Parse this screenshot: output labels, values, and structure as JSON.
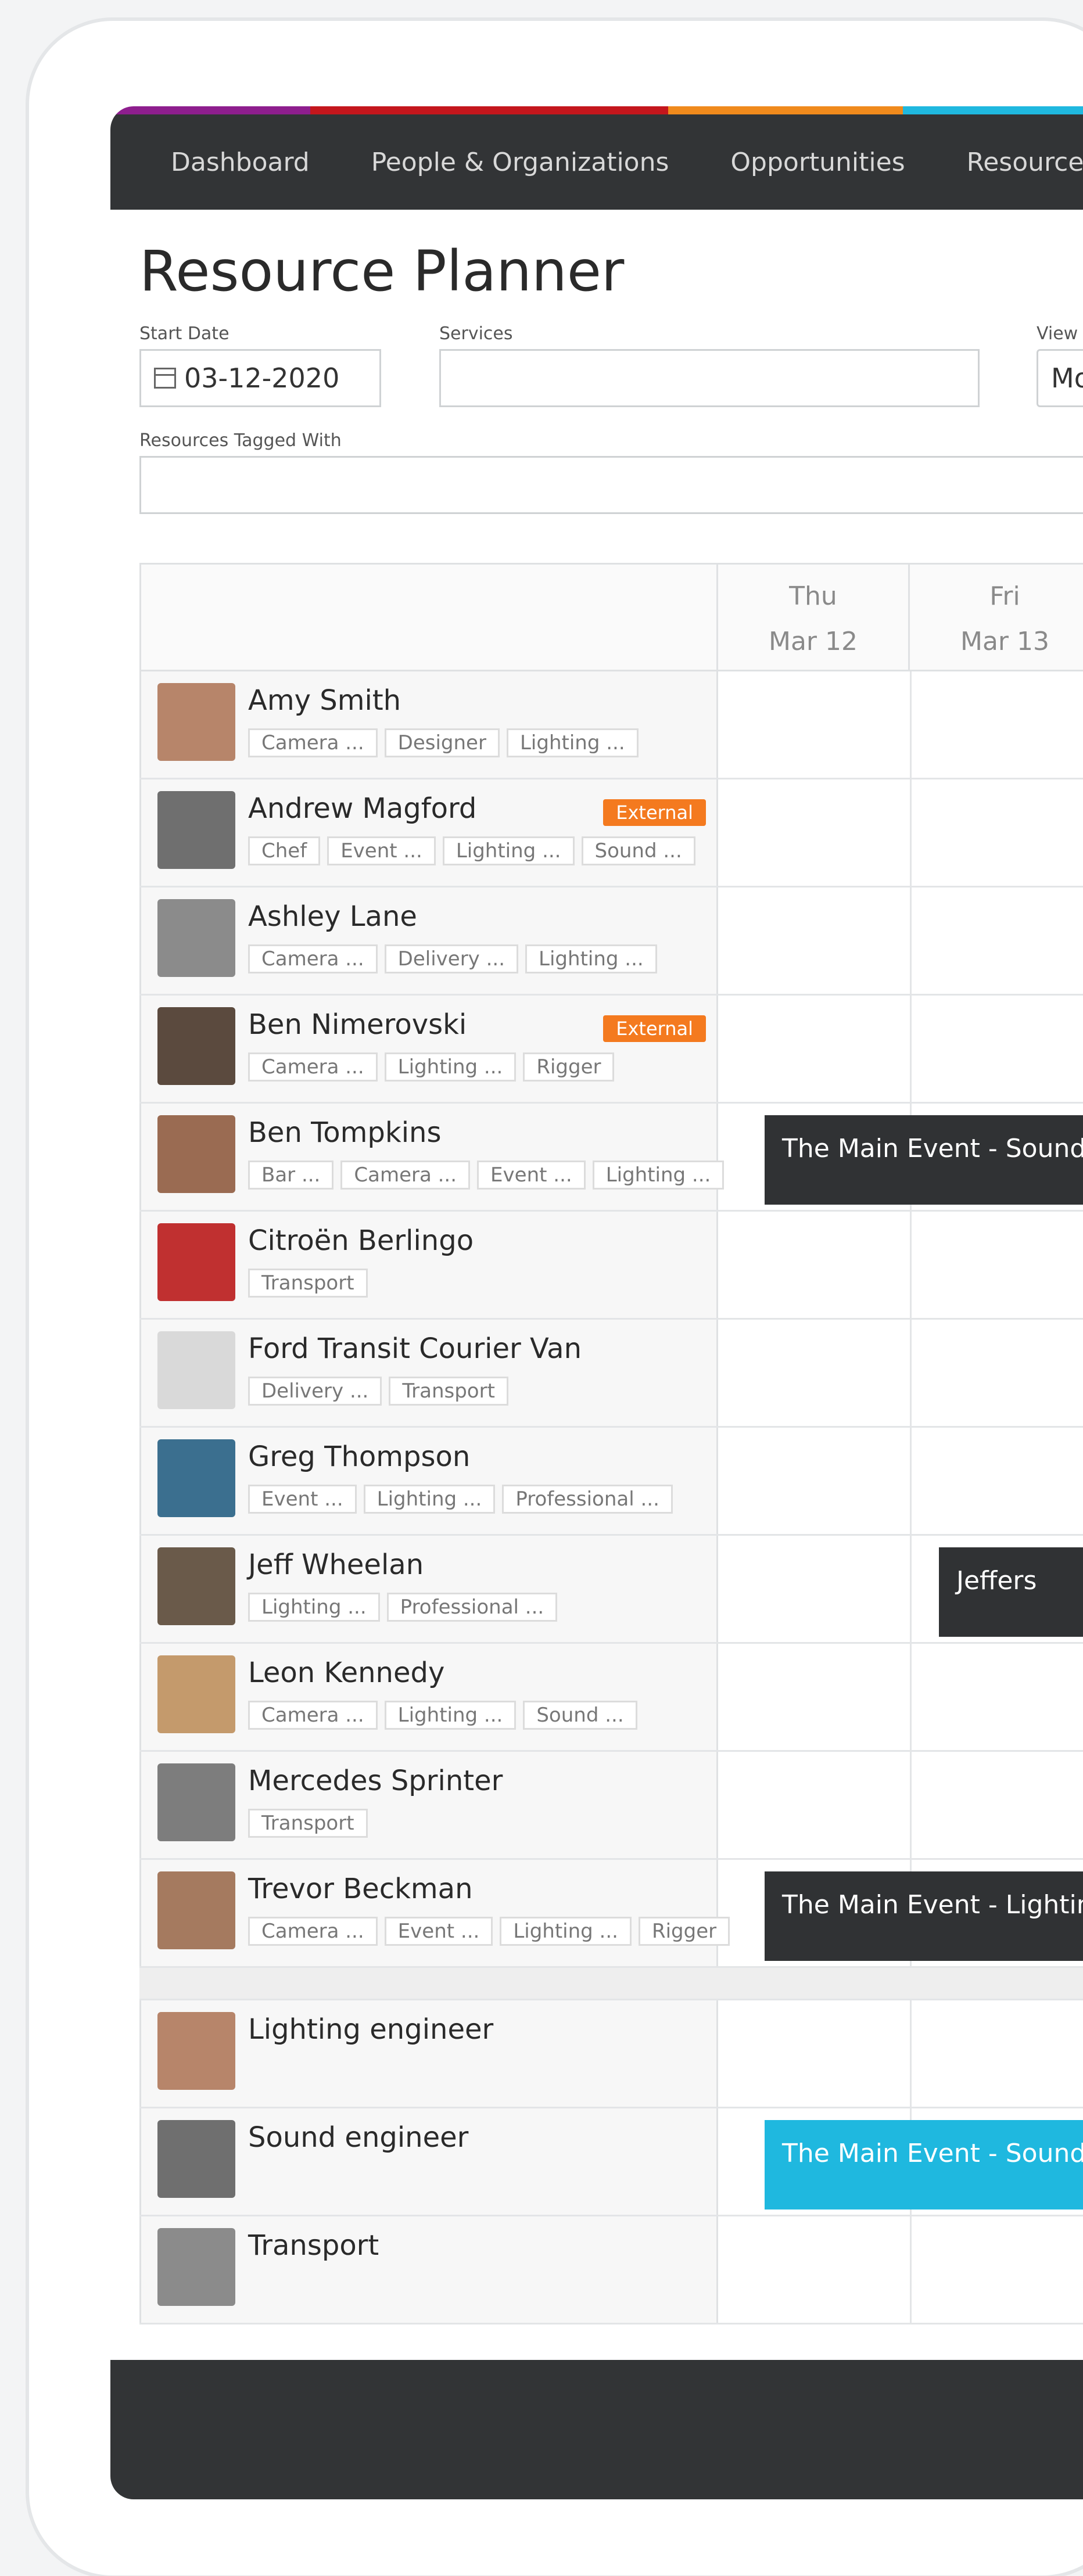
{
  "nav": {
    "items": [
      "Dashboard",
      "People & Organizations",
      "Opportunities",
      "Resource"
    ],
    "strip_colors": [
      "#8e1e8e",
      "#c4161c",
      "#f08a1c",
      "#1fb8df"
    ]
  },
  "page": {
    "title": "Resource Planner",
    "filters": {
      "start_date_label": "Start Date",
      "start_date_value": "03-12-2020",
      "services_label": "Services",
      "services_value": "",
      "view_label": "View",
      "view_value": "Mo",
      "tagged_label": "Resources Tagged With",
      "tagged_value": ""
    }
  },
  "grid": {
    "days": [
      {
        "dow": "Thu",
        "date": "Mar 12"
      },
      {
        "dow": "Fri",
        "date": "Mar 13"
      }
    ],
    "resources": [
      {
        "name": "Amy Smith",
        "tags": [
          "Camera ...",
          "Designer",
          "Lighting ..."
        ],
        "badge": ""
      },
      {
        "name": "Andrew Magford",
        "tags": [
          "Chef",
          "Event ...",
          "Lighting ...",
          "Sound ..."
        ],
        "badge": "External"
      },
      {
        "name": "Ashley Lane",
        "tags": [
          "Camera ...",
          "Delivery ...",
          "Lighting ..."
        ],
        "badge": ""
      },
      {
        "name": "Ben Nimerovski",
        "tags": [
          "Camera ...",
          "Lighting ...",
          "Rigger"
        ],
        "badge": "External"
      },
      {
        "name": "Ben Tompkins",
        "tags": [
          "Bar ...",
          "Camera ...",
          "Event ...",
          "Lighting ..."
        ],
        "badge": "",
        "event": "The Main Event - Sound"
      },
      {
        "name": "Citroën Berlingo",
        "tags": [
          "Transport"
        ],
        "badge": ""
      },
      {
        "name": "Ford Transit Courier Van",
        "tags": [
          "Delivery ...",
          "Transport"
        ],
        "badge": ""
      },
      {
        "name": "Greg Thompson",
        "tags": [
          "Event ...",
          "Lighting ...",
          "Professional ..."
        ],
        "badge": ""
      },
      {
        "name": "Jeff Wheelan",
        "tags": [
          "Lighting ...",
          "Professional ..."
        ],
        "badge": "",
        "event": "Jeffers"
      },
      {
        "name": "Leon Kennedy",
        "tags": [
          "Camera ...",
          "Lighting ...",
          "Sound ..."
        ],
        "badge": ""
      },
      {
        "name": "Mercedes Sprinter",
        "tags": [
          "Transport"
        ],
        "badge": ""
      },
      {
        "name": "Trevor Beckman",
        "tags": [
          "Camera ...",
          "Event ...",
          "Lighting ...",
          "Rigger"
        ],
        "badge": "",
        "event": "The Main Event - Lightin"
      }
    ],
    "services": [
      {
        "name": "Lighting engineer"
      },
      {
        "name": "Sound engineer",
        "event": "The Main Event - Sound"
      },
      {
        "name": "Transport"
      }
    ]
  }
}
